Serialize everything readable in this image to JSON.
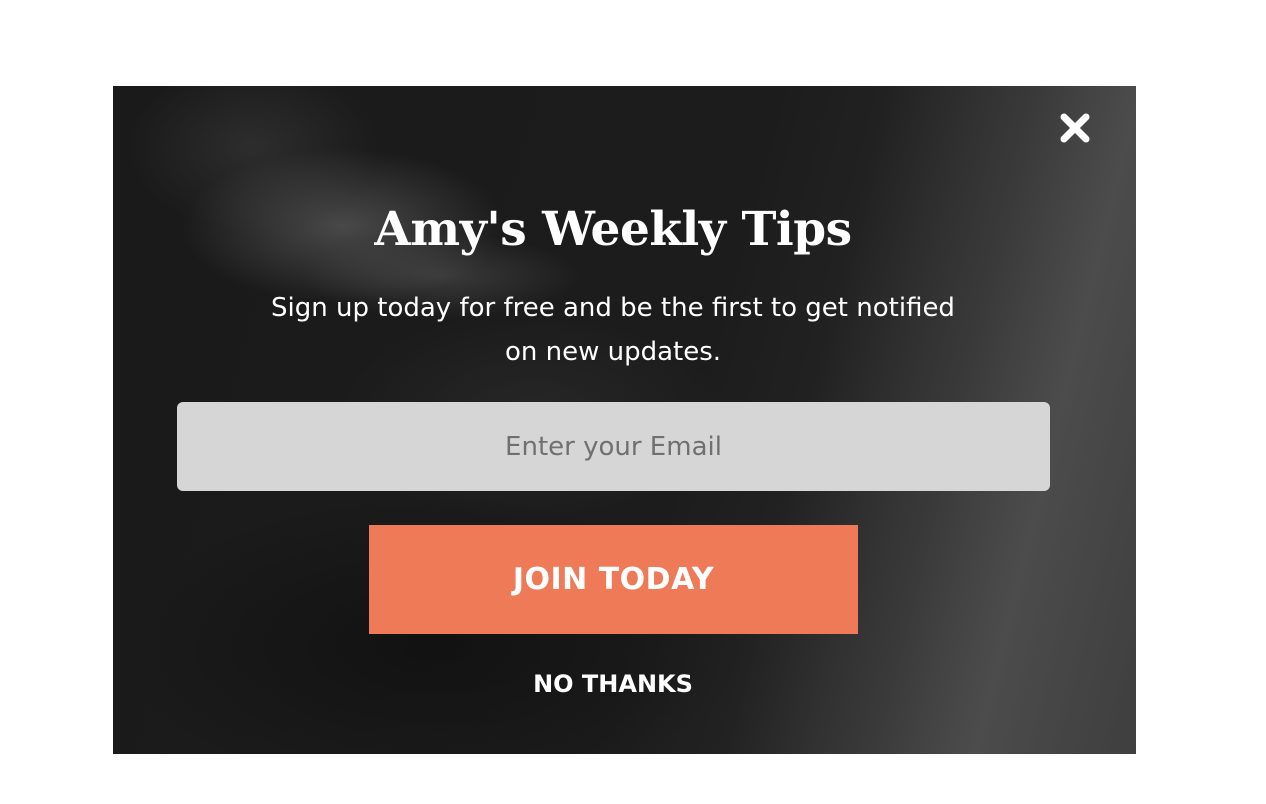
{
  "popup": {
    "title": "Amy's Weekly Tips",
    "subtitle": "Sign up today for free and be the first to get notified on new updates.",
    "email_placeholder": "Enter your Email",
    "email_value": "",
    "join_label": "JOIN TODAY",
    "decline_label": "NO THANKS",
    "close_icon": "close-x-icon"
  },
  "colors": {
    "accent": "#ee7a58",
    "input_bg": "#d6d6d6",
    "text": "#ffffff"
  }
}
